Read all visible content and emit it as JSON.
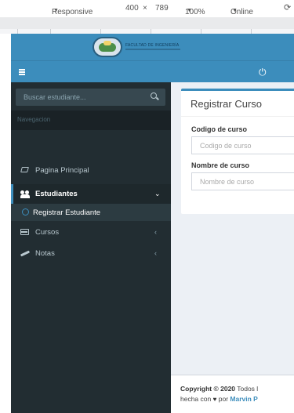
{
  "devtools": {
    "device": "Responsive",
    "width": "400",
    "times": "×",
    "height": "789",
    "zoom": "100%",
    "network": "Online"
  },
  "brand": {
    "logo_text": "FACULTAD DE INGENIERÍA"
  },
  "sidebar": {
    "search_placeholder": "Buscar estudiante...",
    "header": "Navegacion",
    "items": [
      {
        "label": "Pagina Principal",
        "icon": "home-icon"
      },
      {
        "label": "Estudiantes",
        "icon": "users-icon",
        "active": true
      },
      {
        "label": "Registrar Estudiante",
        "icon": "circle-icon",
        "submenu": true
      },
      {
        "label": "Cursos",
        "icon": "card-icon"
      },
      {
        "label": "Notas",
        "icon": "pencil-icon"
      }
    ]
  },
  "main": {
    "box_title": "Registrar Curso",
    "fields": [
      {
        "label": "Codigo de curso",
        "placeholder": "Codigo de curso"
      },
      {
        "label": "Nombre de curso",
        "placeholder": "Nombre de curso"
      }
    ]
  },
  "footer": {
    "copyright": "Copyright © 2020",
    "rights": "Todos l",
    "made_with": "hecha con",
    "by": "por",
    "author": "Marvin P"
  },
  "colors": {
    "primary": "#3c8dbc",
    "sidebar_bg": "#222d32",
    "content_bg": "#ecf0f5"
  }
}
